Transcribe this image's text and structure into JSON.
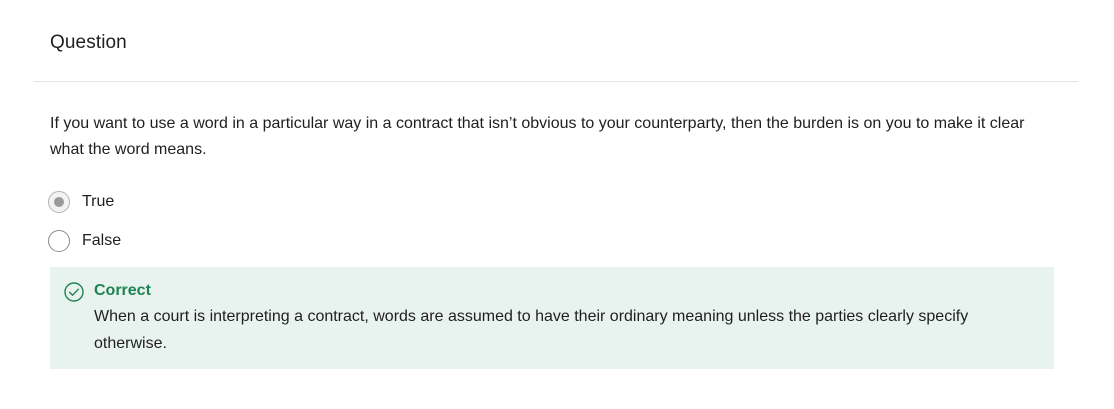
{
  "header": {
    "title": "Question"
  },
  "question": {
    "prompt": "If you want to use a word in a particular way in a contract that isn’t obvious to your counterparty, then the burden is on you to make it clear what the word means.",
    "options": [
      {
        "label": "True",
        "selected": true
      },
      {
        "label": "False",
        "selected": false
      }
    ]
  },
  "feedback": {
    "status": "Correct",
    "explanation": "When a court is interpreting a contract, words are assumed to have their ordinary meaning unless the parties clearly specify otherwise.",
    "icon": "check-circle-icon",
    "status_color": "#1f8354",
    "background_color": "#e8f2ee"
  }
}
